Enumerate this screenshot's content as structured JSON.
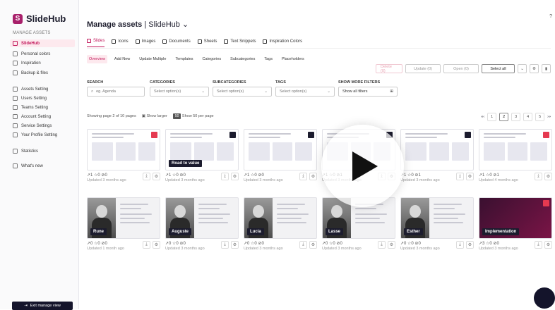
{
  "app": {
    "logo_text": "SlideHub",
    "logo_glyph": "S"
  },
  "sidebar": {
    "section_title": "MANAGE ASSETS",
    "items": [
      {
        "label": "SlideHub",
        "icon": "brand-icon",
        "active": true
      },
      {
        "label": "Personal colors",
        "icon": "palette-icon"
      },
      {
        "label": "Inspiration",
        "icon": "pin-icon"
      },
      {
        "label": "Backup & files",
        "icon": "folder-icon"
      },
      {
        "label": "Assets Setting",
        "icon": "gear-icon"
      },
      {
        "label": "Users Setting",
        "icon": "users-icon"
      },
      {
        "label": "Teams Setting",
        "icon": "team-icon"
      },
      {
        "label": "Account Setting",
        "icon": "key-icon"
      },
      {
        "label": "Service Settings",
        "icon": "service-icon"
      },
      {
        "label": "Your Profile Setting",
        "icon": "profile-icon"
      },
      {
        "label": "Statistics",
        "icon": "chart-icon"
      },
      {
        "label": "What's new",
        "icon": "megaphone-icon"
      }
    ],
    "exit_label": "Exit manage view"
  },
  "header": {
    "title": "Manage assets",
    "workspace": "| SlideHub ⌄",
    "help": "?"
  },
  "type_tabs": [
    {
      "label": "Slides",
      "active": true
    },
    {
      "label": "Icons"
    },
    {
      "label": "Images"
    },
    {
      "label": "Documents"
    },
    {
      "label": "Sheets"
    },
    {
      "label": "Text Snippets"
    },
    {
      "label": "Inspiration Colors"
    }
  ],
  "sub_tabs": [
    {
      "label": "Overview",
      "active": true
    },
    {
      "label": "Add New"
    },
    {
      "label": "Update Multiple"
    },
    {
      "label": "Templates"
    },
    {
      "label": "Categories"
    },
    {
      "label": "Subcategories"
    },
    {
      "label": "Tags"
    },
    {
      "label": "Placeholders"
    }
  ],
  "actions": {
    "delete": "Delete (0)",
    "update": "Update (0)",
    "open": "Open (0)",
    "select_all": "Select all"
  },
  "filters": {
    "search_label": "SEARCH",
    "search_placeholder": "eg. Agenda",
    "categories_label": "CATEGORIES",
    "categories_value": "Select option(s)",
    "subcategories_label": "SUBCATEGORIES",
    "subcategories_value": "Select option(s)",
    "tags_label": "TAGS",
    "tags_value": "Select option(s)",
    "more_label": "SHOW MORE FILTERS",
    "more_value": "Show all filters"
  },
  "listing": {
    "showing": "Showing page 2 of 10 pages",
    "show_larger": "Show larger",
    "per_page_chip": "50",
    "per_page": "Show 50 per page",
    "pages": [
      "1",
      "2",
      "3",
      "4",
      "5"
    ],
    "current_page": "2"
  },
  "cards": [
    {
      "kind": "doc",
      "stats": "↗1 ☆0 ⊘0",
      "updated": "Updated 3 months ago",
      "corner": "red"
    },
    {
      "kind": "doc",
      "stats": "↗1 ☆0 ⊘0",
      "updated": "Updated 3 months ago",
      "tag": "Road to value",
      "corner": "dark"
    },
    {
      "kind": "doc",
      "stats": "↗1 ☆0 ⊘0",
      "updated": "Updated 3 months ago",
      "corner": "dark"
    },
    {
      "kind": "doc",
      "stats": "↗1 ☆0 ⊘1",
      "updated": "Updated 3 months ago",
      "corner": "dark"
    },
    {
      "kind": "doc",
      "stats": "↗1 ☆0 ⊘1",
      "updated": "Updated 3 months ago",
      "corner": "dark"
    },
    {
      "kind": "doc",
      "stats": "↗1 ☆0 ⊘1",
      "updated": "Updated 4 months ago",
      "corner": "red"
    },
    {
      "kind": "person",
      "stats": "↗0 ☆0 ⊘0",
      "updated": "Updated 1 month ago",
      "tag": "Rune"
    },
    {
      "kind": "person",
      "stats": "↗0 ☆0 ⊘0",
      "updated": "Updated 3 months ago",
      "tag": "Auguste"
    },
    {
      "kind": "person",
      "stats": "↗0 ☆0 ⊘0",
      "updated": "Updated 3 months ago",
      "tag": "Lucia"
    },
    {
      "kind": "person",
      "stats": "↗0 ☆0 ⊘0",
      "updated": "Updated 3 months ago",
      "tag": "Lasse"
    },
    {
      "kind": "person",
      "stats": "↗0 ☆0 ⊘0",
      "updated": "Updated 3 months ago",
      "tag": "Esther"
    },
    {
      "kind": "dark",
      "stats": "↗3 ☆0 ⊘0",
      "updated": "Updated 3 months ago",
      "tag": "Implementation",
      "corner": "red"
    }
  ],
  "colors": {
    "accent": "#c2185b",
    "dark": "#14142b"
  }
}
